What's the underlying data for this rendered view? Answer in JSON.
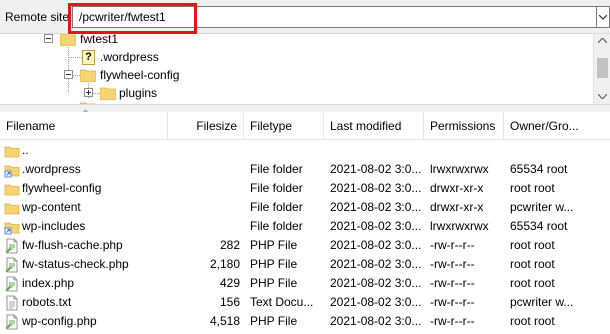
{
  "remote_site": {
    "label": "Remote site:",
    "path": "/pcwriter/fwtest1"
  },
  "tree": {
    "items": [
      {
        "label": "fwtest1",
        "icon": "folder-icon",
        "expander": "minus"
      },
      {
        "label": ".wordpress",
        "icon": "unknown-question-icon",
        "expander": "none"
      },
      {
        "label": "flywheel-config",
        "icon": "folder-icon",
        "expander": "minus"
      },
      {
        "label": "plugins",
        "icon": "folder-icon",
        "expander": "plus"
      }
    ]
  },
  "file_list": {
    "columns": [
      "Filename",
      "Filesize",
      "Filetype",
      "Last modified",
      "Permissions",
      "Owner/Gro..."
    ],
    "rows": [
      {
        "name": "..",
        "size": "",
        "type": "",
        "modified": "",
        "permissions": "",
        "owner": "",
        "icon": "folder-icon"
      },
      {
        "name": ".wordpress",
        "size": "",
        "type": "File folder",
        "modified": "2021-08-02 3:0...",
        "permissions": "lrwxrwxrwx",
        "owner": "65534 root",
        "icon": "folder-link-icon"
      },
      {
        "name": "flywheel-config",
        "size": "",
        "type": "File folder",
        "modified": "2021-08-02 3:0...",
        "permissions": "drwxr-xr-x",
        "owner": "root root",
        "icon": "folder-icon"
      },
      {
        "name": "wp-content",
        "size": "",
        "type": "File folder",
        "modified": "2021-08-02 3:0...",
        "permissions": "drwxr-xr-x",
        "owner": "pcwriter w...",
        "icon": "folder-icon"
      },
      {
        "name": "wp-includes",
        "size": "",
        "type": "File folder",
        "modified": "2021-08-02 3:0...",
        "permissions": "lrwxrwxrwx",
        "owner": "65534 root",
        "icon": "folder-link-icon"
      },
      {
        "name": "fw-flush-cache.php",
        "size": "282",
        "type": "PHP File",
        "modified": "2021-08-02 3:0...",
        "permissions": "-rw-r--r--",
        "owner": "root root",
        "icon": "php-file-icon"
      },
      {
        "name": "fw-status-check.php",
        "size": "2,180",
        "type": "PHP File",
        "modified": "2021-08-02 3:0...",
        "permissions": "-rw-r--r--",
        "owner": "root root",
        "icon": "php-file-icon"
      },
      {
        "name": "index.php",
        "size": "429",
        "type": "PHP File",
        "modified": "2021-08-02 3:0...",
        "permissions": "-rw-r--r--",
        "owner": "root root",
        "icon": "php-file-icon"
      },
      {
        "name": "robots.txt",
        "size": "156",
        "type": "Text Docu...",
        "modified": "2021-08-02 3:0...",
        "permissions": "-rw-r--r--",
        "owner": "pcwriter w...",
        "icon": "text-file-icon"
      },
      {
        "name": "wp-config.php",
        "size": "4,518",
        "type": "PHP File",
        "modified": "2021-08-02 3:0...",
        "permissions": "-rw-r--r--",
        "owner": "root root",
        "icon": "php-file-icon"
      }
    ]
  },
  "colors": {
    "highlight": "#e8131a",
    "folder": "#f6d471",
    "folder_dark": "#dcb14a",
    "background": "#ffffff",
    "chrome": "#f0f0f0"
  }
}
